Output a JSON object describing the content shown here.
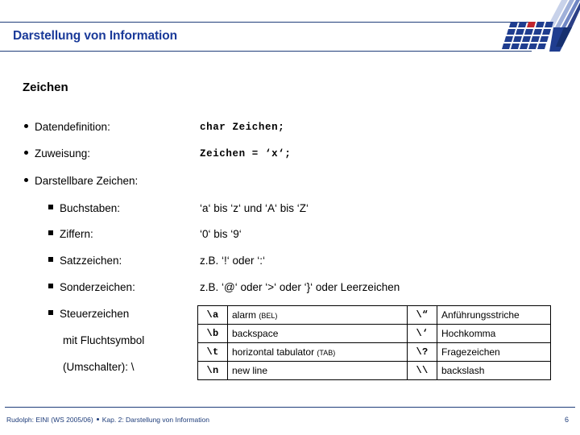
{
  "header": {
    "title": "Darstellung von Information",
    "logo_name": "tu-dortmund-logo",
    "title_color": "#1a3a99",
    "rule_color": "#1f3d7a"
  },
  "main": {
    "section_heading": "Zeichen",
    "items": [
      {
        "level": 1,
        "label": "Datendefinition:",
        "value": "char Zeichen;",
        "value_style": "mono"
      },
      {
        "level": 1,
        "label": "Zuweisung:",
        "value": "Zeichen = ‘x‘;",
        "value_style": "mono"
      },
      {
        "level": 1,
        "label": "Darstellbare Zeichen:",
        "value": "",
        "value_style": "none"
      },
      {
        "level": 2,
        "label": "Buchstaben:",
        "value": "‘a‘ bis ‘z‘ und ‘A‘ bis ‘Z‘",
        "value_style": "mixed"
      },
      {
        "level": 2,
        "label": "Ziffern:",
        "value": "‘0‘ bis ‘9‘",
        "value_style": "mixed"
      },
      {
        "level": 2,
        "label": "Satzzeichen:",
        "value": "z.B. ‘!‘ oder ‘:‘",
        "value_style": "mixed"
      },
      {
        "level": 2,
        "label": "Sonderzeichen:",
        "value": "z.B. ‘@‘ oder ‘>‘ oder ‘}‘ oder Leerzeichen",
        "value_style": "mixed"
      },
      {
        "level": 2,
        "label": "Steuerzeichen",
        "value": "",
        "value_style": "none"
      }
    ],
    "steuerzeichen_continuation": [
      "mit Fluchtsymbol",
      "(Umschalter): \\"
    ]
  },
  "escape_table": {
    "rows": [
      {
        "code_l": "\\a",
        "desc_l": "alarm",
        "abbr_l": "(BEL)",
        "code_r": "\\“",
        "desc_r": "Anführungsstriche",
        "abbr_r": ""
      },
      {
        "code_l": "\\b",
        "desc_l": "backspace",
        "abbr_l": "",
        "code_r": "\\‘",
        "desc_r": "Hochkomma",
        "abbr_r": ""
      },
      {
        "code_l": "\\t",
        "desc_l": "horizontal tabulator",
        "abbr_l": "(TAB)",
        "code_r": "\\?",
        "desc_r": "Fragezeichen",
        "abbr_r": ""
      },
      {
        "code_l": "\\n",
        "desc_l": "new line",
        "abbr_l": "",
        "code_r": "\\\\",
        "desc_r": "backslash",
        "abbr_r": ""
      }
    ]
  },
  "footer": {
    "author_course": "Rudolph: EINI (WS 2005/06)",
    "chapter": "Kap. 2: Darstellung von Information",
    "page_number": "6",
    "color": "#1f3d7a"
  }
}
